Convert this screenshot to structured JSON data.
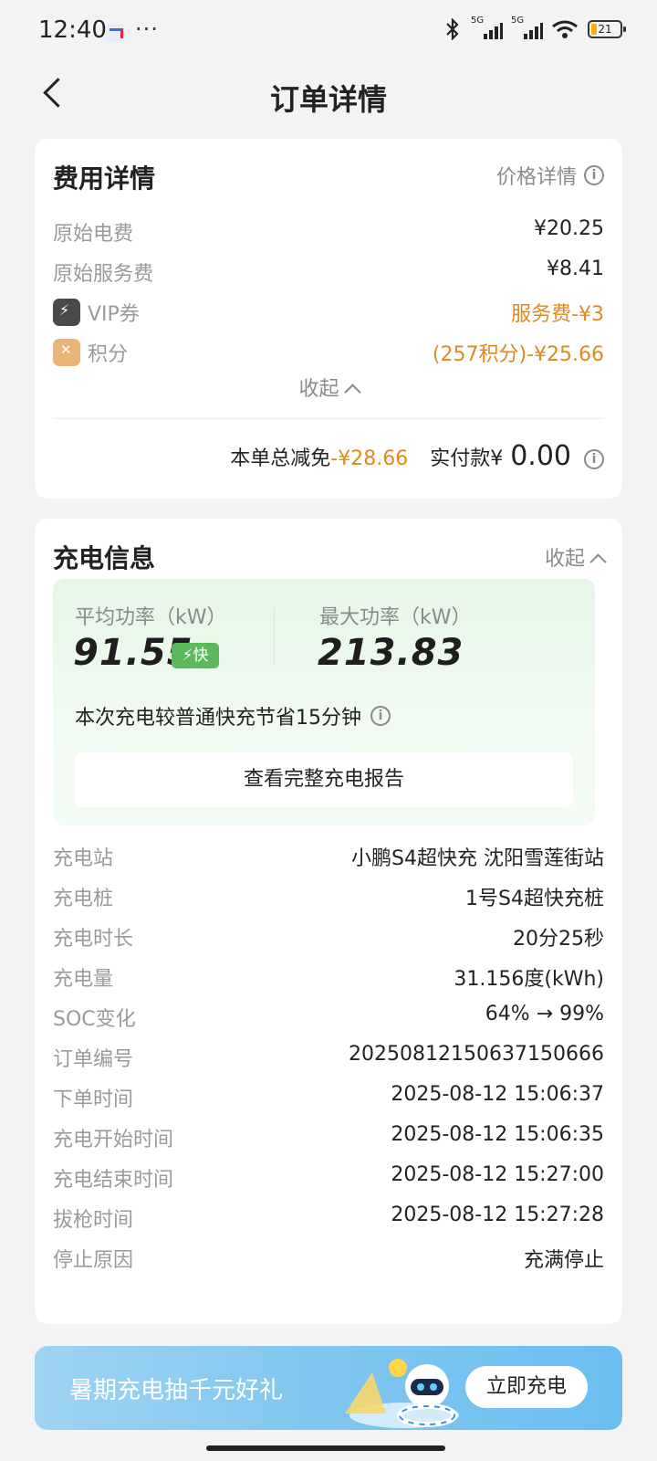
{
  "status_bar": {
    "time": "12:40",
    "more": "···",
    "battery": "21",
    "net1": "5G",
    "net2": "5G"
  },
  "nav": {
    "title": "订单详情"
  },
  "fee_card": {
    "title": "费用详情",
    "price_detail_link": "价格详情",
    "rows": [
      {
        "label": "原始电费",
        "value": "¥20.25"
      },
      {
        "label": "原始服务费",
        "value": "¥8.41"
      },
      {
        "label": "VIP券",
        "value": "服务费-¥3"
      },
      {
        "label": "积分",
        "value": "(257积分)-¥25.66"
      }
    ],
    "collapse_label": "收起",
    "total_discount_label": "本单总减免",
    "total_discount_value": "-¥28.66",
    "paid_label": "实付款¥",
    "paid_value": "0.00"
  },
  "charge_card": {
    "title": "充电信息",
    "collapse_label": "收起",
    "avg_power_label": "平均功率（kW）",
    "avg_power_value": "91.55",
    "fast_tag": "⚡快",
    "max_power_label": "最大功率（kW）",
    "max_power_value": "213.83",
    "save_text": "本次充电较普通快充节省15分钟",
    "report_button": "查看完整充电报告",
    "rows": [
      {
        "label": "充电站",
        "value": "小鹏S4超快充 沈阳雪莲街站"
      },
      {
        "label": "充电桩",
        "value": "1号S4超快充桩"
      },
      {
        "label": "充电时长",
        "value": "20分25秒"
      },
      {
        "label": "充电量",
        "value": "31.156度(kWh)"
      },
      {
        "label": "SOC变化",
        "value": "64% → 99%"
      },
      {
        "label": "订单编号",
        "value": "20250812150637150666"
      },
      {
        "label": "下单时间",
        "value": "2025-08-12 15:06:37"
      },
      {
        "label": "充电开始时间",
        "value": "2025-08-12 15:06:35"
      },
      {
        "label": "充电结束时间",
        "value": "2025-08-12 15:27:00"
      },
      {
        "label": "拔枪时间",
        "value": "2025-08-12 15:27:28"
      },
      {
        "label": "停止原因",
        "value": "充满停止"
      }
    ]
  },
  "banner": {
    "text": "暑期充电抽千元好礼",
    "button": "立即充电"
  },
  "colors": {
    "accent_orange": "#e08a1e",
    "fast_green": "#5cb85c",
    "banner_blue": "#7fc6ef"
  }
}
